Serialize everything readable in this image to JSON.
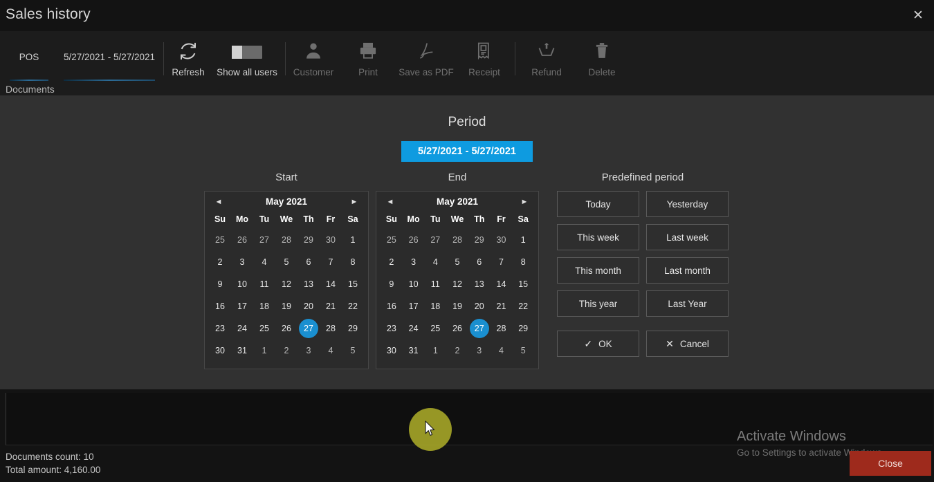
{
  "window": {
    "title": "Sales history",
    "close_icon": "close-icon"
  },
  "toolbar": {
    "tabs": [
      {
        "label": "POS",
        "name": "tab-pos"
      },
      {
        "label": "5/27/2021 - 5/27/2021",
        "name": "tab-date-range"
      }
    ],
    "buttons": [
      {
        "label": "Refresh",
        "icon": "refresh-icon",
        "enabled": true
      },
      {
        "label": "Show all users",
        "icon": "toggle-switch-icon",
        "enabled": true
      },
      {
        "label": "Customer",
        "icon": "user-icon",
        "enabled": false
      },
      {
        "label": "Print",
        "icon": "printer-icon",
        "enabled": false
      },
      {
        "label": "Save as PDF",
        "icon": "pdf-icon",
        "enabled": false
      },
      {
        "label": "Receipt",
        "icon": "receipt-icon",
        "enabled": false
      },
      {
        "label": "Refund",
        "icon": "refund-icon",
        "enabled": false
      },
      {
        "label": "Delete",
        "icon": "trash-icon",
        "enabled": false
      }
    ]
  },
  "content": {
    "section_label": "Documents"
  },
  "overlay": {
    "heading": "Period",
    "range_button": "5/27/2021 - 5/27/2021",
    "start_title": "Start",
    "end_title": "End",
    "predefined_title": "Predefined period",
    "day_names": [
      "Su",
      "Mo",
      "Tu",
      "We",
      "Th",
      "Fr",
      "Sa"
    ],
    "prev_arrow": "◄",
    "next_arrow": "►",
    "start_calendar": {
      "month_label": "May 2021",
      "selected_day": 27,
      "weeks": [
        [
          {
            "d": "25",
            "out": true
          },
          {
            "d": "26",
            "out": true
          },
          {
            "d": "27",
            "out": true
          },
          {
            "d": "28",
            "out": true
          },
          {
            "d": "29",
            "out": true
          },
          {
            "d": "30",
            "out": true
          },
          {
            "d": "1",
            "out": false
          }
        ],
        [
          {
            "d": "2",
            "out": false
          },
          {
            "d": "3",
            "out": false
          },
          {
            "d": "4",
            "out": false
          },
          {
            "d": "5",
            "out": false
          },
          {
            "d": "6",
            "out": false
          },
          {
            "d": "7",
            "out": false
          },
          {
            "d": "8",
            "out": false
          }
        ],
        [
          {
            "d": "9",
            "out": false
          },
          {
            "d": "10",
            "out": false
          },
          {
            "d": "11",
            "out": false
          },
          {
            "d": "12",
            "out": false
          },
          {
            "d": "13",
            "out": false
          },
          {
            "d": "14",
            "out": false
          },
          {
            "d": "15",
            "out": false
          }
        ],
        [
          {
            "d": "16",
            "out": false
          },
          {
            "d": "17",
            "out": false
          },
          {
            "d": "18",
            "out": false
          },
          {
            "d": "19",
            "out": false
          },
          {
            "d": "20",
            "out": false
          },
          {
            "d": "21",
            "out": false
          },
          {
            "d": "22",
            "out": false
          }
        ],
        [
          {
            "d": "23",
            "out": false
          },
          {
            "d": "24",
            "out": false
          },
          {
            "d": "25",
            "out": false
          },
          {
            "d": "26",
            "out": false
          },
          {
            "d": "27",
            "out": false,
            "sel": true
          },
          {
            "d": "28",
            "out": false
          },
          {
            "d": "29",
            "out": false
          }
        ],
        [
          {
            "d": "30",
            "out": false
          },
          {
            "d": "31",
            "out": false
          },
          {
            "d": "1",
            "out": true
          },
          {
            "d": "2",
            "out": true
          },
          {
            "d": "3",
            "out": true
          },
          {
            "d": "4",
            "out": true
          },
          {
            "d": "5",
            "out": true
          }
        ]
      ]
    },
    "end_calendar": {
      "month_label": "May 2021",
      "selected_day": 27,
      "hovered_day": 25,
      "weeks": [
        [
          {
            "d": "25",
            "out": true
          },
          {
            "d": "26",
            "out": true
          },
          {
            "d": "27",
            "out": true
          },
          {
            "d": "28",
            "out": true
          },
          {
            "d": "29",
            "out": true
          },
          {
            "d": "30",
            "out": true
          },
          {
            "d": "1",
            "out": false
          }
        ],
        [
          {
            "d": "2",
            "out": false
          },
          {
            "d": "3",
            "out": false
          },
          {
            "d": "4",
            "out": false
          },
          {
            "d": "5",
            "out": false
          },
          {
            "d": "6",
            "out": false
          },
          {
            "d": "7",
            "out": false
          },
          {
            "d": "8",
            "out": false
          }
        ],
        [
          {
            "d": "9",
            "out": false
          },
          {
            "d": "10",
            "out": false
          },
          {
            "d": "11",
            "out": false
          },
          {
            "d": "12",
            "out": false
          },
          {
            "d": "13",
            "out": false
          },
          {
            "d": "14",
            "out": false
          },
          {
            "d": "15",
            "out": false
          }
        ],
        [
          {
            "d": "16",
            "out": false
          },
          {
            "d": "17",
            "out": false
          },
          {
            "d": "18",
            "out": false
          },
          {
            "d": "19",
            "out": false
          },
          {
            "d": "20",
            "out": false
          },
          {
            "d": "21",
            "out": false
          },
          {
            "d": "22",
            "out": false
          }
        ],
        [
          {
            "d": "23",
            "out": false
          },
          {
            "d": "24",
            "out": false
          },
          {
            "d": "25",
            "out": false
          },
          {
            "d": "26",
            "out": false
          },
          {
            "d": "27",
            "out": false,
            "sel": true
          },
          {
            "d": "28",
            "out": false
          },
          {
            "d": "29",
            "out": false
          }
        ],
        [
          {
            "d": "30",
            "out": false
          },
          {
            "d": "31",
            "out": false
          },
          {
            "d": "1",
            "out": true
          },
          {
            "d": "2",
            "out": true
          },
          {
            "d": "3",
            "out": true
          },
          {
            "d": "4",
            "out": true
          },
          {
            "d": "5",
            "out": true
          }
        ]
      ]
    },
    "predefined": [
      "Today",
      "Yesterday",
      "This week",
      "Last week",
      "This month",
      "Last month",
      "This year",
      "Last Year"
    ],
    "ok_label": "OK",
    "cancel_label": "Cancel",
    "ok_icon": "check-icon",
    "cancel_icon": "x-icon"
  },
  "status": {
    "documents_count": "Documents count: 10",
    "total_amount": "Total amount: 4,160.00"
  },
  "watermark": {
    "line1": "Activate Windows",
    "line2": "Go to Settings to activate Windows."
  },
  "close_button": {
    "label": "Close"
  },
  "colors": {
    "accent_blue": "#0e9be0",
    "selected_day": "#1a8fd0",
    "cursor_halo": "#a3a327",
    "close_red": "#9e2a1c",
    "overlay_bg": "#313131",
    "window_bg": "#0e0e0e"
  }
}
